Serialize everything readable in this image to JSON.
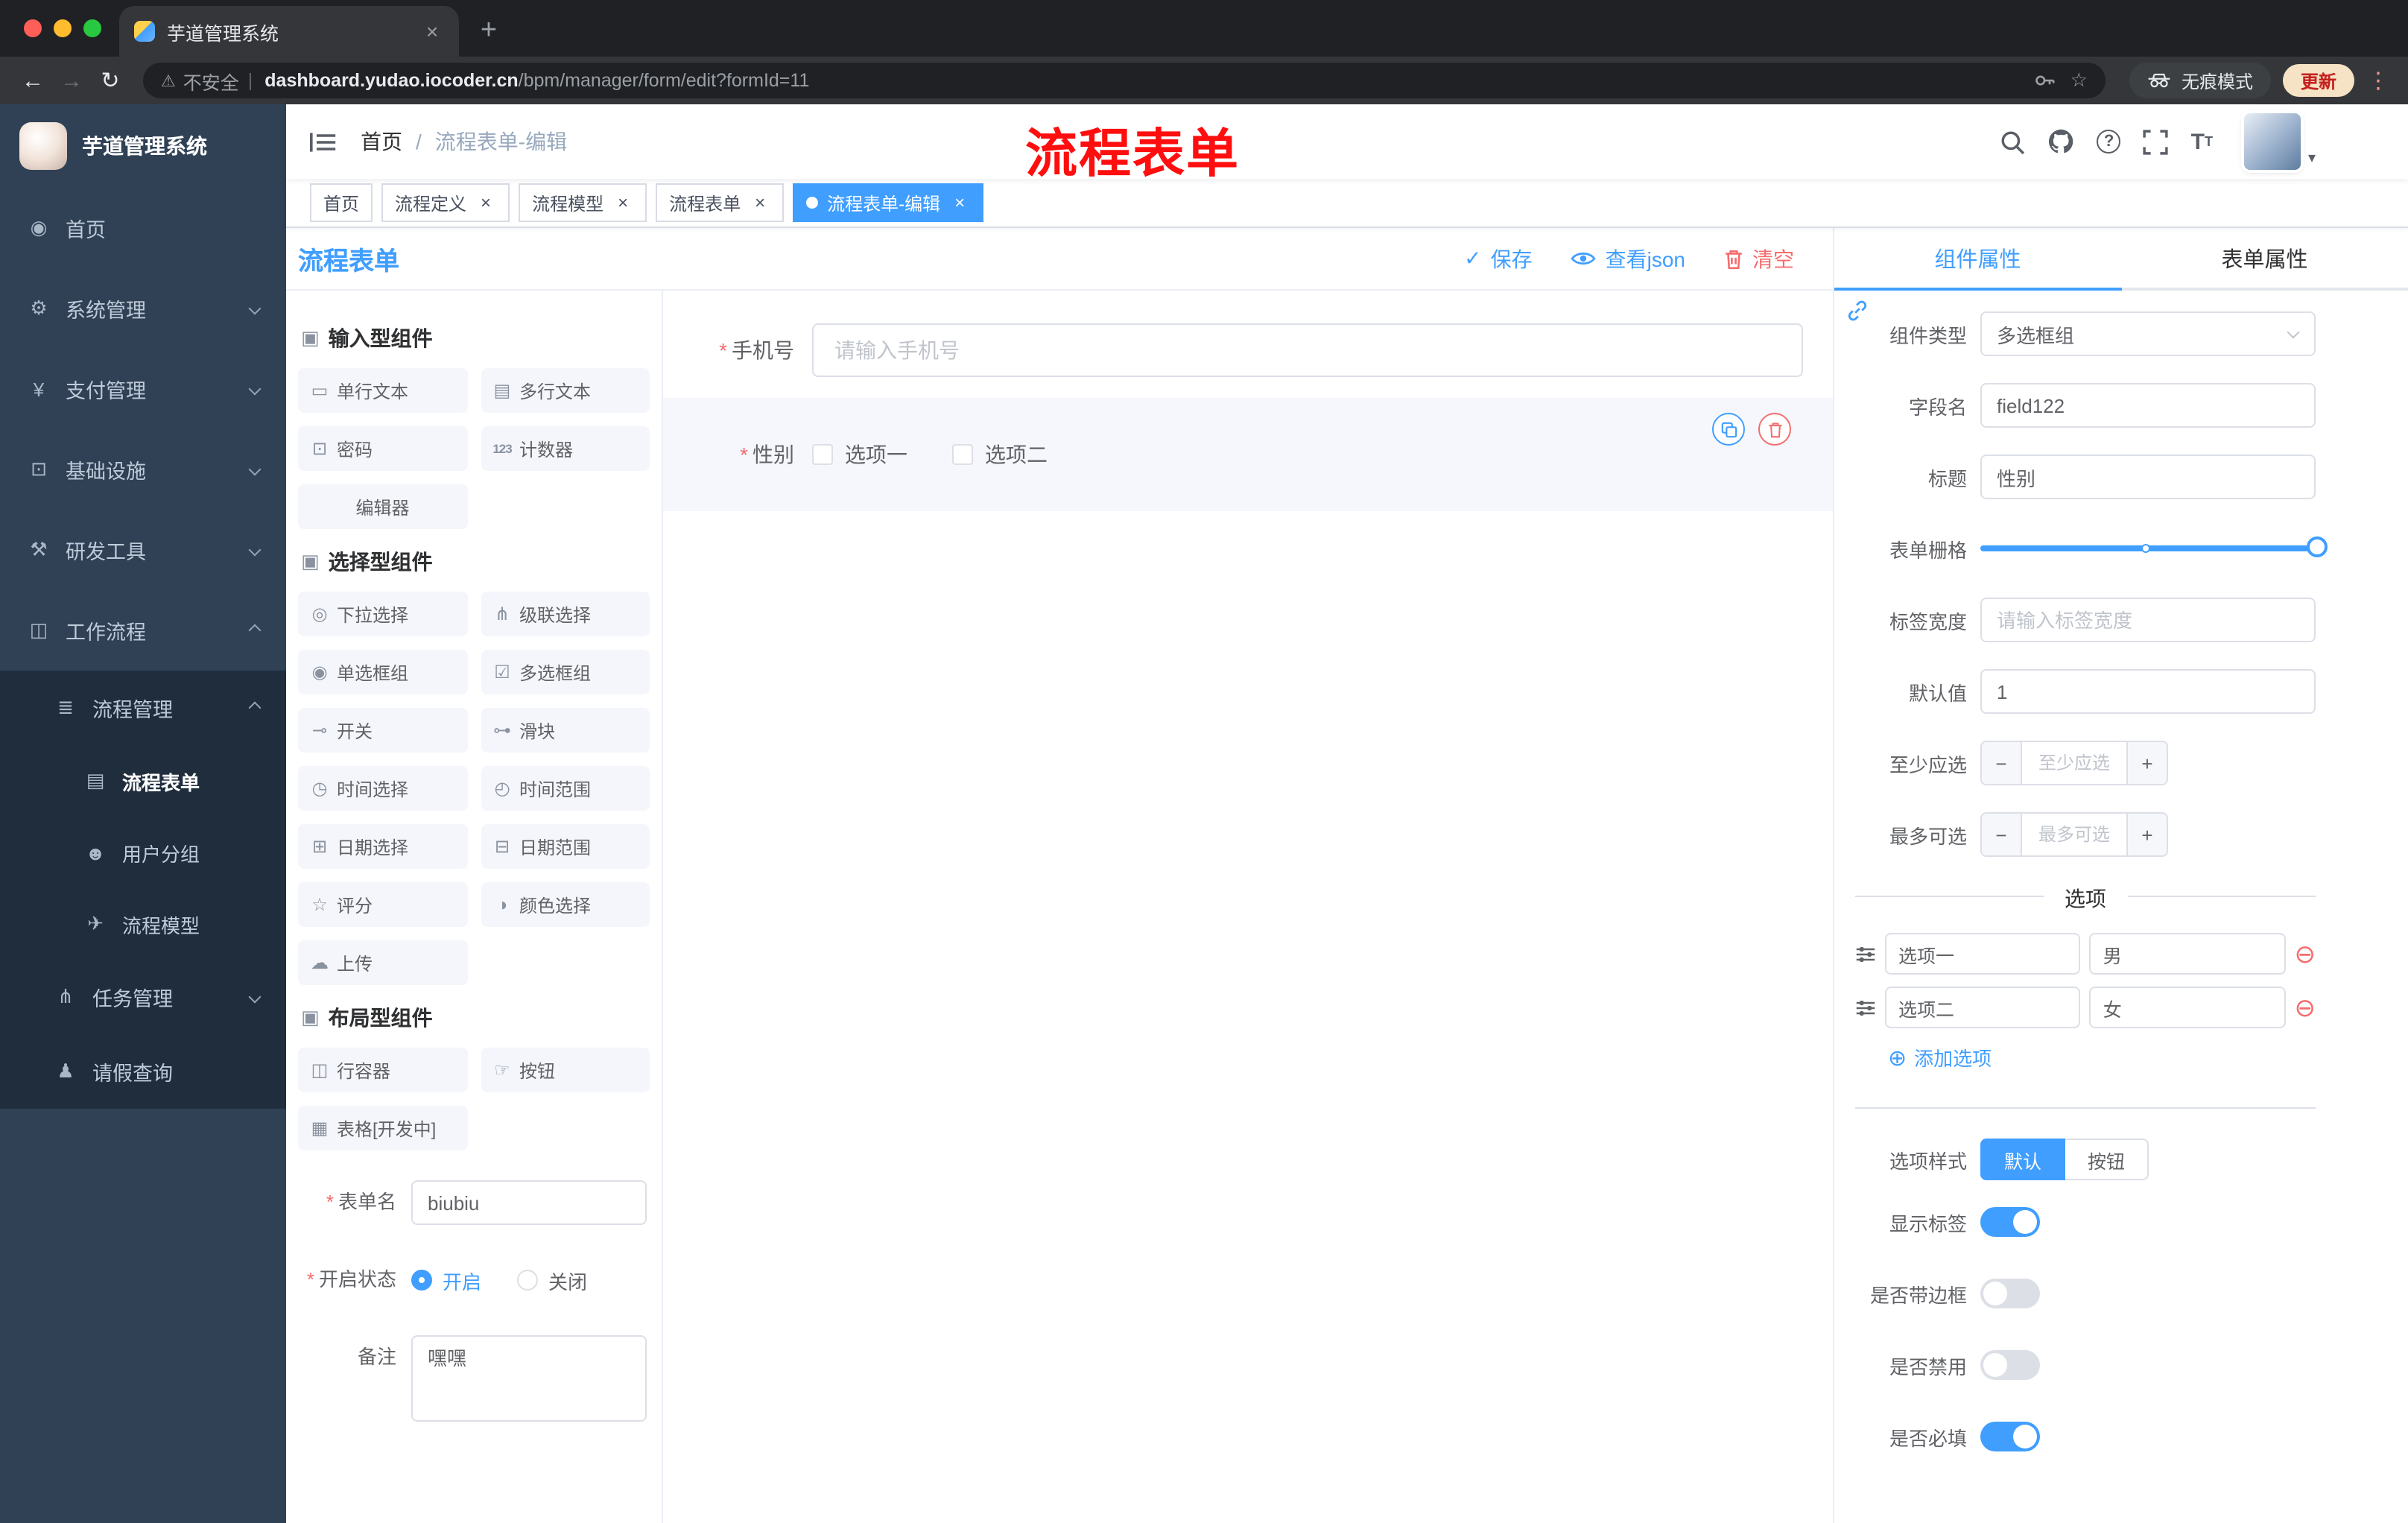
{
  "browser": {
    "tab_title": "芋道管理系统",
    "security_label": "不安全",
    "url_host": "dashboard.yudao.iocoder.cn",
    "url_path": "/bpm/manager/form/edit?formId=11",
    "incognito_label": "无痕模式",
    "update_label": "更新"
  },
  "sidebar": {
    "app_title": "芋道管理系统",
    "items": [
      {
        "icon": "◉",
        "label": "首页"
      },
      {
        "icon": "⚙",
        "label": "系统管理"
      },
      {
        "icon": "¥",
        "label": "支付管理"
      },
      {
        "icon": "⊡",
        "label": "基础设施"
      },
      {
        "icon": "⚒",
        "label": "研发工具"
      },
      {
        "icon": "◫",
        "label": "工作流程"
      },
      {
        "icon": "≣",
        "label": "流程管理"
      },
      {
        "icon": "▤",
        "label": "流程表单"
      },
      {
        "icon": "☻",
        "label": "用户分组"
      },
      {
        "icon": "✈",
        "label": "流程模型"
      },
      {
        "icon": "⋔",
        "label": "任务管理"
      },
      {
        "icon": "♟",
        "label": "请假查询"
      }
    ]
  },
  "header": {
    "breadcrumb_root": "首页",
    "breadcrumb_separator": "/",
    "breadcrumb_current": "流程表单-编辑",
    "annotation": "流程表单"
  },
  "tags": [
    {
      "label": "首页"
    },
    {
      "label": "流程定义"
    },
    {
      "label": "流程模型"
    },
    {
      "label": "流程表单"
    },
    {
      "label": "流程表单-编辑"
    }
  ],
  "designer": {
    "page_title": "流程表单",
    "save_label": "保存",
    "view_json_label": "查看json",
    "clear_label": "清空",
    "groups": [
      {
        "title": "输入型组件",
        "items": [
          {
            "icon": "▭",
            "label": "单行文本"
          },
          {
            "icon": "▤",
            "label": "多行文本"
          },
          {
            "icon": "⊡",
            "label": "密码"
          },
          {
            "icon": "123",
            "label": "计数器"
          },
          {
            "icon": "",
            "label": "编辑器"
          }
        ]
      },
      {
        "title": "选择型组件",
        "items": [
          {
            "icon": "◎",
            "label": "下拉选择"
          },
          {
            "icon": "⋔",
            "label": "级联选择"
          },
          {
            "icon": "◉",
            "label": "单选框组"
          },
          {
            "icon": "☑",
            "label": "多选框组"
          },
          {
            "icon": "⊸",
            "label": "开关"
          },
          {
            "icon": "⊶",
            "label": "滑块"
          },
          {
            "icon": "◷",
            "label": "时间选择"
          },
          {
            "icon": "◴",
            "label": "时间范围"
          },
          {
            "icon": "⊞",
            "label": "日期选择"
          },
          {
            "icon": "⊟",
            "label": "日期范围"
          },
          {
            "icon": "☆",
            "label": "评分"
          },
          {
            "icon": "◑",
            "label": "颜色选择"
          },
          {
            "icon": "☁",
            "label": "上传"
          }
        ]
      },
      {
        "title": "布局型组件",
        "items": [
          {
            "icon": "◫",
            "label": "行容器"
          },
          {
            "icon": "☞",
            "label": "按钮"
          },
          {
            "icon": "▦",
            "label": "表格[开发中]"
          }
        ]
      }
    ],
    "meta": {
      "name_label": "表单名",
      "name_value": "biubiu",
      "status_label": "开启状态",
      "status_on": "开启",
      "status_off": "关闭",
      "remark_label": "备注",
      "remark_value": "嘿嘿"
    }
  },
  "canvas": {
    "phone_label": "手机号",
    "phone_placeholder": "请输入手机号",
    "gender_label": "性别",
    "gender_options": [
      "选项一",
      "选项二"
    ]
  },
  "props": {
    "tab_component": "组件属性",
    "tab_form": "表单属性",
    "rows": {
      "component_type_label": "组件类型",
      "component_type_value": "多选框组",
      "field_name_label": "字段名",
      "field_name_value": "field122",
      "title_label": "标题",
      "title_value": "性别",
      "grid_label": "表单栅格",
      "label_width_label": "标签宽度",
      "label_width_placeholder": "请输入标签宽度",
      "default_label": "默认值",
      "default_value": "1",
      "min_label": "至少应选",
      "min_placeholder": "至少应选",
      "max_label": "最多可选",
      "max_placeholder": "最多可选"
    },
    "options_title": "选项",
    "options": [
      {
        "label": "选项一",
        "value": "男"
      },
      {
        "label": "选项二",
        "value": "女"
      }
    ],
    "add_option_label": "添加选项",
    "option_style_label": "选项样式",
    "option_style_choices": [
      "默认",
      "按钮"
    ],
    "option_style_selected": "默认",
    "toggles": [
      {
        "label": "显示标签",
        "on": true
      },
      {
        "label": "是否带边框",
        "on": false
      },
      {
        "label": "是否禁用",
        "on": false
      },
      {
        "label": "是否必填",
        "on": true
      }
    ]
  }
}
